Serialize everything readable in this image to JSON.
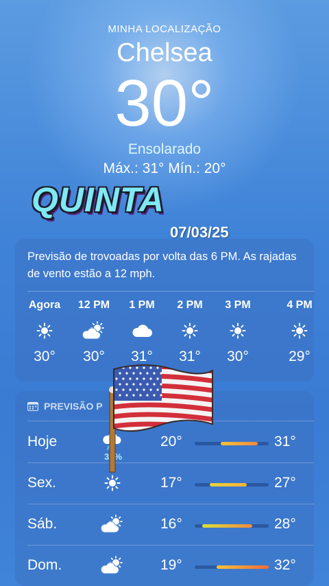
{
  "location": {
    "label": "MINHA LOCALIZAÇÃO",
    "city": "Chelsea",
    "temp": "30°",
    "condition": "Ensolarado",
    "hilo": "Máx.: 31°  Mín.: 20°"
  },
  "sticker": {
    "day": "QUINTA",
    "date": "07/03/25"
  },
  "hourly": {
    "summary": "Previsão de trovoadas por volta das 6 PM. As rajadas de vento estão a 12 mph.",
    "items": [
      {
        "time": "Agora",
        "icon": "sun-icon",
        "temp": "30°"
      },
      {
        "time": "12 PM",
        "icon": "partly-cloudy-icon",
        "temp": "30°"
      },
      {
        "time": "1 PM",
        "icon": "cloud-icon",
        "temp": "31°"
      },
      {
        "time": "2 PM",
        "icon": "sun-icon",
        "temp": "31°"
      },
      {
        "time": "3 PM",
        "icon": "sun-icon",
        "temp": "30°"
      },
      {
        "time": "4 PM",
        "icon": "sun-icon",
        "temp": "29°"
      }
    ]
  },
  "daily": {
    "header": "PREVISÃO P",
    "items": [
      {
        "day": "Hoje",
        "icon": "rain-cloud-icon",
        "precip": "35%",
        "low": "20°",
        "high": "31°",
        "range_start": 0.35,
        "range_end": 0.85,
        "colors": "#f6c33a,#f08a3a"
      },
      {
        "day": "Sex.",
        "icon": "sun-icon",
        "precip": "",
        "low": "17°",
        "high": "27°",
        "range_start": 0.2,
        "range_end": 0.7,
        "colors": "#e8d23a,#f6b33a"
      },
      {
        "day": "Sáb.",
        "icon": "partly-cloudy-icon",
        "precip": "",
        "low": "16°",
        "high": "28°",
        "range_start": 0.1,
        "range_end": 0.78,
        "colors": "#d8e23a,#f08a3a"
      },
      {
        "day": "Dom.",
        "icon": "partly-cloudy-icon",
        "precip": "",
        "low": "19°",
        "high": "32°",
        "range_start": 0.3,
        "range_end": 1.0,
        "colors": "#f6c33a,#ef6a3a"
      }
    ]
  }
}
